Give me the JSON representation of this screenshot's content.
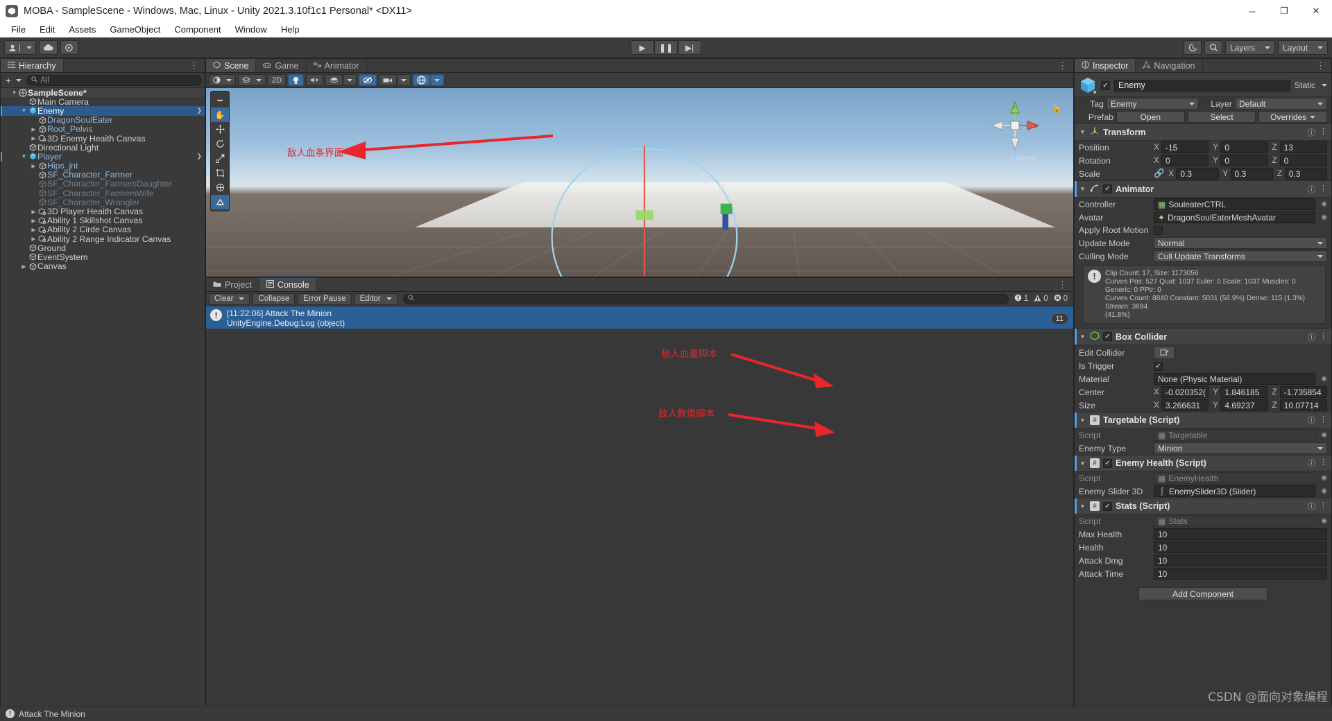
{
  "window": {
    "title": "MOBA - SampleScene - Windows, Mac, Linux - Unity 2021.3.10f1c1 Personal* <DX11>",
    "minimize": "─",
    "maximize": "❐",
    "close": "✕"
  },
  "menu": [
    "File",
    "Edit",
    "Assets",
    "GameObject",
    "Component",
    "Window",
    "Help"
  ],
  "toolbar": {
    "account_icon": "account-icon",
    "cloud_icon": "cloud-icon",
    "collab_icon": "collab-icon",
    "play": "▶",
    "pause": "❚❚",
    "step": "▶|",
    "history_icon": "history-icon",
    "search_icon": "search-icon",
    "layers_label": "Layers",
    "layout_label": "Layout"
  },
  "hierarchy": {
    "tab": "Hierarchy",
    "tab_icon": "hierarchy-icon",
    "add_label": "+",
    "search_placeholder": "All",
    "search_icon": "search-icon",
    "items": [
      {
        "label": "SampleScene*",
        "depth": 0,
        "twisty": "down",
        "kind": "scene",
        "icon": "scene-icon"
      },
      {
        "label": "Main Camera",
        "depth": 1,
        "twisty": "",
        "kind": "normal",
        "icon": "gameobject-icon"
      },
      {
        "label": "Enemy",
        "depth": 1,
        "twisty": "down",
        "kind": "selected-prefab",
        "icon": "prefab-icon",
        "more": "›"
      },
      {
        "label": "DragonSoulEater",
        "depth": 2,
        "twisty": "",
        "kind": "prefab",
        "icon": "gameobject-icon"
      },
      {
        "label": "Root_Pelvis",
        "depth": 2,
        "twisty": "right",
        "kind": "prefab",
        "icon": "gameobject-icon"
      },
      {
        "label": "3D Enemy Heaith Canvas",
        "depth": 2,
        "twisty": "right",
        "kind": "normal",
        "icon": "canvas-icon"
      },
      {
        "label": "Directional Light",
        "depth": 1,
        "twisty": "",
        "kind": "normal",
        "icon": "gameobject-icon"
      },
      {
        "label": "Player",
        "depth": 1,
        "twisty": "down",
        "kind": "prefab-root",
        "icon": "prefab-icon",
        "more": "›"
      },
      {
        "label": "Hips_jnt",
        "depth": 2,
        "twisty": "right",
        "kind": "prefab",
        "icon": "gameobject-icon"
      },
      {
        "label": "SF_Character_Farmer",
        "depth": 2,
        "twisty": "",
        "kind": "prefab",
        "icon": "gameobject-icon"
      },
      {
        "label": "SF_Character_FarmersDaughter",
        "depth": 2,
        "twisty": "",
        "kind": "dim",
        "icon": "gameobject-icon"
      },
      {
        "label": "SF_Character_FarmersWife",
        "depth": 2,
        "twisty": "",
        "kind": "dim",
        "icon": "gameobject-icon"
      },
      {
        "label": "SF_Character_Wrangler",
        "depth": 2,
        "twisty": "",
        "kind": "dim",
        "icon": "gameobject-icon"
      },
      {
        "label": "3D Player Heaith Canvas",
        "depth": 2,
        "twisty": "right",
        "kind": "normal",
        "icon": "canvas-icon"
      },
      {
        "label": "Ability 1 Skillshot Canvas",
        "depth": 2,
        "twisty": "right",
        "kind": "normal",
        "icon": "canvas-icon"
      },
      {
        "label": "Ability 2 Cirde Canvas",
        "depth": 2,
        "twisty": "right",
        "kind": "normal",
        "icon": "canvas-icon"
      },
      {
        "label": "Ability 2 Range Indicator Canvas",
        "depth": 2,
        "twisty": "right",
        "kind": "normal",
        "icon": "canvas-icon"
      },
      {
        "label": "Ground",
        "depth": 1,
        "twisty": "",
        "kind": "normal",
        "icon": "gameobject-icon"
      },
      {
        "label": "EventSystem",
        "depth": 1,
        "twisty": "",
        "kind": "normal",
        "icon": "gameobject-icon"
      },
      {
        "label": "Canvas",
        "depth": 1,
        "twisty": "right",
        "kind": "normal",
        "icon": "gameobject-icon"
      }
    ]
  },
  "scene": {
    "tabs": [
      {
        "label": "Scene",
        "icon": "scene-tab-icon",
        "active": true
      },
      {
        "label": "Game",
        "icon": "game-tab-icon",
        "active": false
      },
      {
        "label": "Animator",
        "icon": "animator-tab-icon",
        "active": false
      }
    ],
    "toolbar": {
      "shading_mode": "Shaded",
      "draw_mode_icon": "shading-icon",
      "twod_label": "2D",
      "light_icon": "light-icon",
      "audio_icon": "audio-mute-icon",
      "fx_icon": "effects-icon",
      "gizmos_icon": "gizmos-hidden-icon",
      "camera_icon": "scene-camera-icon",
      "gizmo_toggle_icon": "gizmo-sphere-icon"
    },
    "tools": [
      "hand-tool",
      "move-tool",
      "rotate-tool",
      "scale-tool",
      "rect-tool",
      "transform-tool",
      "custom-tool"
    ],
    "persp_label": "Persp",
    "gizmo_axes": {
      "x": "x",
      "y": "y",
      "z": "z"
    },
    "annotation": "敌人血条界面"
  },
  "console": {
    "tabs": [
      {
        "label": "Project",
        "icon": "folder-icon",
        "active": false
      },
      {
        "label": "Console",
        "icon": "console-icon",
        "active": true
      }
    ],
    "clear_label": "Clear",
    "collapse_label": "Collapse",
    "error_pause_label": "Error Pause",
    "editor_label": "Editor",
    "search_placeholder": "",
    "search_icon": "search-icon",
    "counts": {
      "info": "1",
      "warn": "0",
      "error": "0"
    },
    "entry": {
      "line1": "[11:22:06] Attack The Minion",
      "line2": "UnityEngine.Debug:Log (object)",
      "count": "11"
    }
  },
  "inspector": {
    "tabs": [
      {
        "label": "Inspector",
        "icon": "info-icon",
        "active": true
      },
      {
        "label": "Navigation",
        "icon": "navigation-icon",
        "active": false
      }
    ],
    "object_name": "Enemy",
    "enabled_check": "✓",
    "static_label": "Static",
    "tag_label": "Tag",
    "tag_value": "Enemy",
    "layer_label": "Layer",
    "layer_value": "Default",
    "prefab_label": "Prefab",
    "prefab_open": "Open",
    "prefab_select": "Select",
    "prefab_overrides": "Overrides",
    "transform": {
      "title": "Transform",
      "icon": "transform-icon",
      "position_label": "Position",
      "position": {
        "x": "-15",
        "y": "0",
        "z": "13"
      },
      "rotation_label": "Rotation",
      "rotation": {
        "x": "0",
        "y": "0",
        "z": "0"
      },
      "scale_label": "Scale",
      "scale": {
        "x": "0.3",
        "y": "0.3",
        "z": "0.3"
      },
      "scale_lock_icon": "linked-scale-icon"
    },
    "animator": {
      "title": "Animator",
      "icon": "animator-icon",
      "controller_label": "Controller",
      "controller_value": "SouleaterCTRL",
      "avatar_label": "Avatar",
      "avatar_value": "DragonSoulEaterMeshAvatar",
      "apply_root_label": "Apply Root Motion",
      "apply_root_checked": false,
      "update_mode_label": "Update Mode",
      "update_mode_value": "Normal",
      "culling_mode_label": "Culling Mode",
      "culling_mode_value": "Cull Update Transforms",
      "info_lines": [
        "Clip Count: 17, Size: 1173056",
        "Curves Pos: 527 Quat: 1037 Euler: 0 Scale: 1037 Muscles: 0 Generic: 0 PPtr: 0",
        "Curves Count: 8840 Constant: 5031 (56.9%) Dense: 115 (1.3%) Stream: 3694",
        "(41.8%)"
      ]
    },
    "box_collider": {
      "title": "Box Collider",
      "icon": "collider-icon",
      "enabled": true,
      "edit_collider_label": "Edit Collider",
      "edit_collider_icon": "edit-collider-icon",
      "is_trigger_label": "Is Trigger",
      "is_trigger_checked": true,
      "material_label": "Material",
      "material_value": "None (Physic Material)",
      "center_label": "Center",
      "center": {
        "x": "-0.020352(",
        "y": "1.846185",
        "z": "-1.735854"
      },
      "size_label": "Size",
      "size": {
        "x": "3.266631",
        "y": "4.69237",
        "z": "10.07714"
      }
    },
    "targetable": {
      "title": "Targetable (Script)",
      "icon": "script-icon",
      "script_label": "Script",
      "script_value": "Targetable",
      "enemy_type_label": "Enemy Type",
      "enemy_type_value": "Minion"
    },
    "enemy_health": {
      "title": "Enemy Health (Script)",
      "icon": "script-icon",
      "enabled": true,
      "script_label": "Script",
      "script_value": "EnemyHealth",
      "slider_label": "Enemy Slider 3D",
      "slider_value": "EnemySlider3D (Slider)"
    },
    "stats": {
      "title": "Stats (Script)",
      "icon": "script-icon",
      "enabled": true,
      "script_label": "Script",
      "script_value": "Stats",
      "fields": [
        {
          "label": "Max Health",
          "value": "10"
        },
        {
          "label": "Health",
          "value": "10"
        },
        {
          "label": "Attack Dmg",
          "value": "10"
        },
        {
          "label": "Attack Time",
          "value": "10"
        }
      ]
    },
    "add_component": "Add Component",
    "annotations": [
      {
        "text": "敌人血量脚本"
      },
      {
        "text": "敌人数值脚本"
      }
    ]
  },
  "statusbar": {
    "message": "Attack The Minion",
    "icon": "info-icon"
  },
  "watermark": "CSDN @面向对象编程",
  "colors": {
    "accent": "#2b5b8c",
    "annotation_red": "#e8262c",
    "panel_bg": "#383838",
    "highlight_blue": "#4d9fe8"
  }
}
